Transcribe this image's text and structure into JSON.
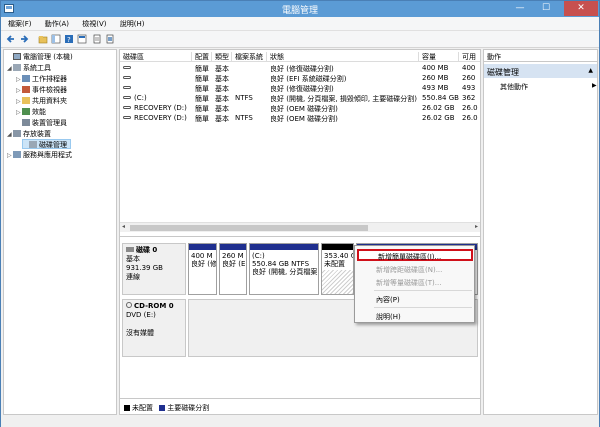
{
  "window": {
    "title": "電腦管理",
    "minimize": "—",
    "maximize": "☐",
    "close": "✕"
  },
  "menubar": [
    "檔案(F)",
    "動作(A)",
    "檢視(V)",
    "說明(H)"
  ],
  "tree": {
    "items": [
      {
        "label": "電腦管理 (本機)",
        "arrow": ""
      },
      {
        "label": "系統工具",
        "arrow": "◢"
      },
      {
        "label": "工作排程器",
        "arrow": "▷"
      },
      {
        "label": "事件檢視器",
        "arrow": "▷"
      },
      {
        "label": "共用資料夾",
        "arrow": "▷"
      },
      {
        "label": "效能",
        "arrow": "▷"
      },
      {
        "label": "裝置管理員",
        "arrow": ""
      },
      {
        "label": "存放裝置",
        "arrow": "◢"
      },
      {
        "label": "磁碟管理",
        "arrow": ""
      },
      {
        "label": "服務與應用程式",
        "arrow": "▷"
      }
    ]
  },
  "volumes": {
    "headers": [
      "磁碟區",
      "配置",
      "類型",
      "檔案系統",
      "狀態",
      "容量",
      "可用"
    ],
    "rows": [
      [
        "",
        "簡單",
        "基本",
        "",
        "良好 (修復磁碟分割)",
        "400 MB",
        "400"
      ],
      [
        "",
        "簡單",
        "基本",
        "",
        "良好 (EFI 系統磁碟分割)",
        "260 MB",
        "260"
      ],
      [
        "",
        "簡單",
        "基本",
        "",
        "良好 (修復磁碟分割)",
        "493 MB",
        "493"
      ],
      [
        "(C:)",
        "簡單",
        "基本",
        "NTFS",
        "良好 (開機, 分頁檔案, 損毀傾印, 主要磁碟分割)",
        "550.84 GB",
        "362"
      ],
      [
        "RECOVERY (D:)",
        "簡單",
        "基本",
        "",
        "良好 (OEM 磁碟分割)",
        "26.02 GB",
        "26.0"
      ],
      [
        "RECOVERY (D:)",
        "簡單",
        "基本",
        "NTFS",
        "良好 (OEM 磁碟分割)",
        "26.02 GB",
        "26.0"
      ]
    ]
  },
  "disk0": {
    "name": "磁碟 0",
    "type": "基本",
    "size": "931.39 GB",
    "state": "連線",
    "partitions": [
      {
        "l1": "400 M",
        "l2": "良好 (修",
        "color": "#1f2f8f"
      },
      {
        "l1": "260 M",
        "l2": "良好 (E",
        "color": "#1f2f8f"
      },
      {
        "l1": "(C:)",
        "l2": "550.84 GB NTFS",
        "l3": "良好 (開機, 分頁檔案",
        "color": "#1f2f8f"
      },
      {
        "l1": "353.40 G",
        "l2": "未配置",
        "color": "#000000"
      },
      {
        "l1": "",
        "l2": "",
        "color": "#1f2f8f"
      }
    ]
  },
  "cdrom": {
    "name": "CD-ROM 0",
    "drive": "DVD (E:)",
    "media": "沒有媒體"
  },
  "legend": [
    {
      "label": "未配置",
      "color": "#000000"
    },
    {
      "label": "主要磁碟分割",
      "color": "#1f2f8f"
    }
  ],
  "actions": {
    "header": "動作",
    "section": "磁碟管理",
    "section_arrow": "▲",
    "more": "其他動作",
    "more_arrow": "▶"
  },
  "context_menu": [
    {
      "label": "新增簡單磁碟區(I)...",
      "enabled": true
    },
    {
      "label": "新增跨距磁碟區(N)...",
      "enabled": false
    },
    {
      "label": "新增等量磁碟區(T)...",
      "enabled": false
    },
    {
      "label": "內容(P)",
      "enabled": true
    },
    {
      "label": "說明(H)",
      "enabled": true
    }
  ],
  "colors": {
    "titlebar": "#5b9bd5",
    "primary_partition": "#1f2f8f",
    "unallocated": "#000000",
    "highlight_border": "#d0101a"
  }
}
